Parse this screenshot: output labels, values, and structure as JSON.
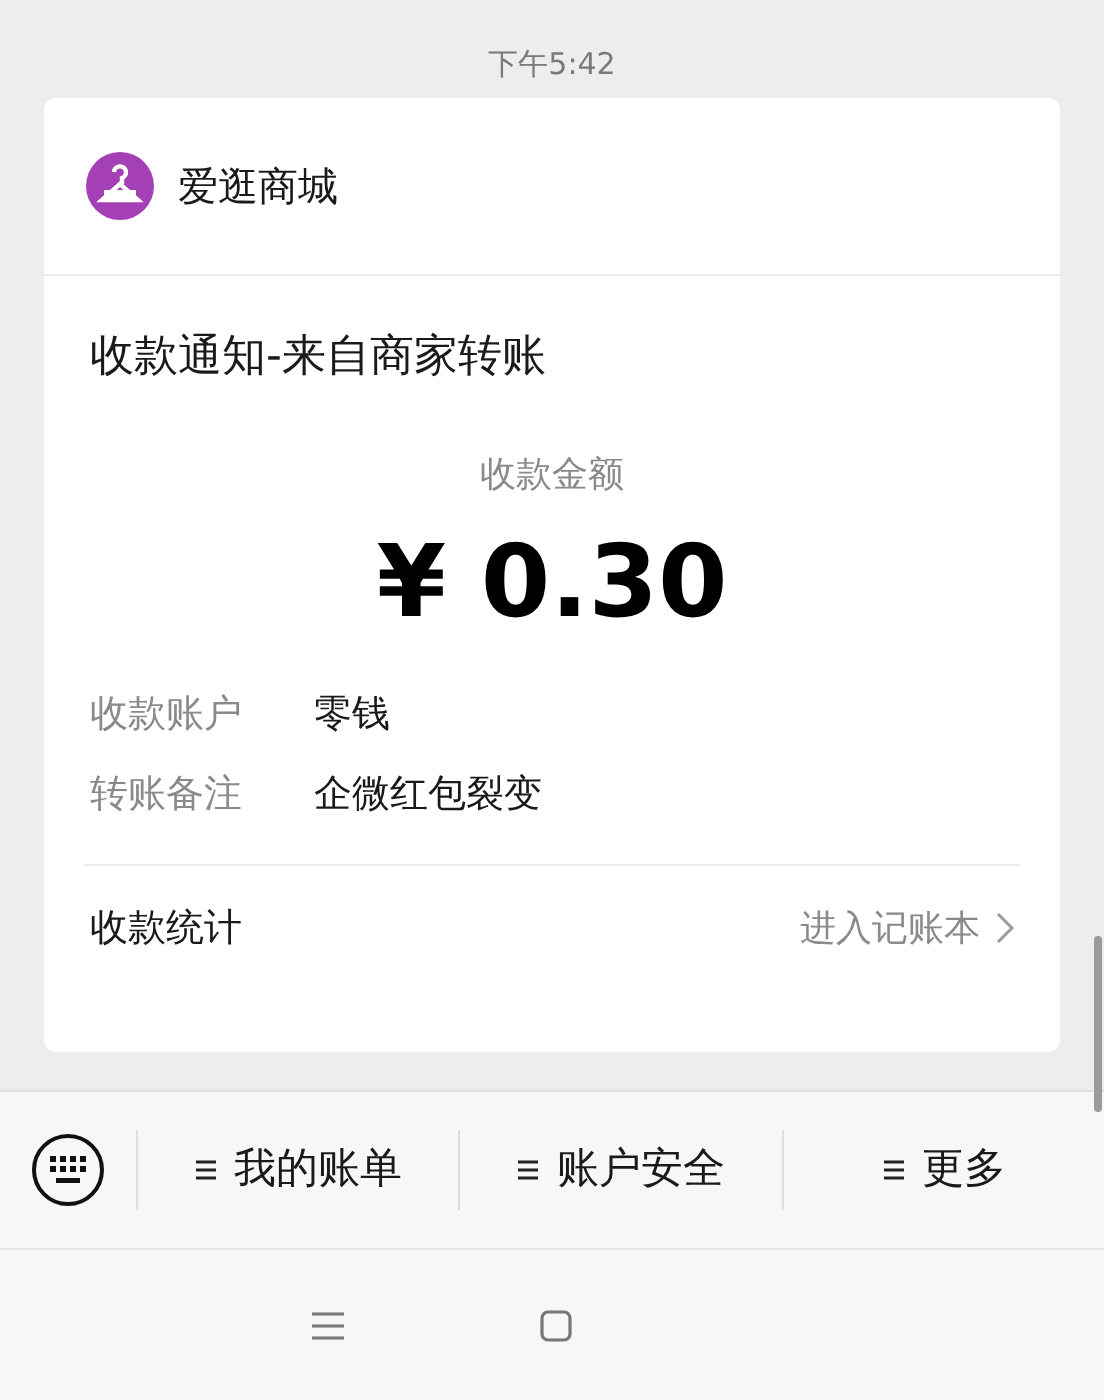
{
  "time": "下午5:42",
  "card": {
    "merchant": "爱逛商城",
    "title": "收款通知-来自商家转账",
    "amount_label": "收款金额",
    "amount": "¥ 0.30",
    "details": [
      {
        "label": "收款账户",
        "value": "零钱"
      },
      {
        "label": "转账备注",
        "value": "企微红包裂变"
      }
    ],
    "footer": {
      "label": "收款统计",
      "link": "进入记账本"
    }
  },
  "menu": [
    "我的账单",
    "账户安全",
    "更多"
  ]
}
